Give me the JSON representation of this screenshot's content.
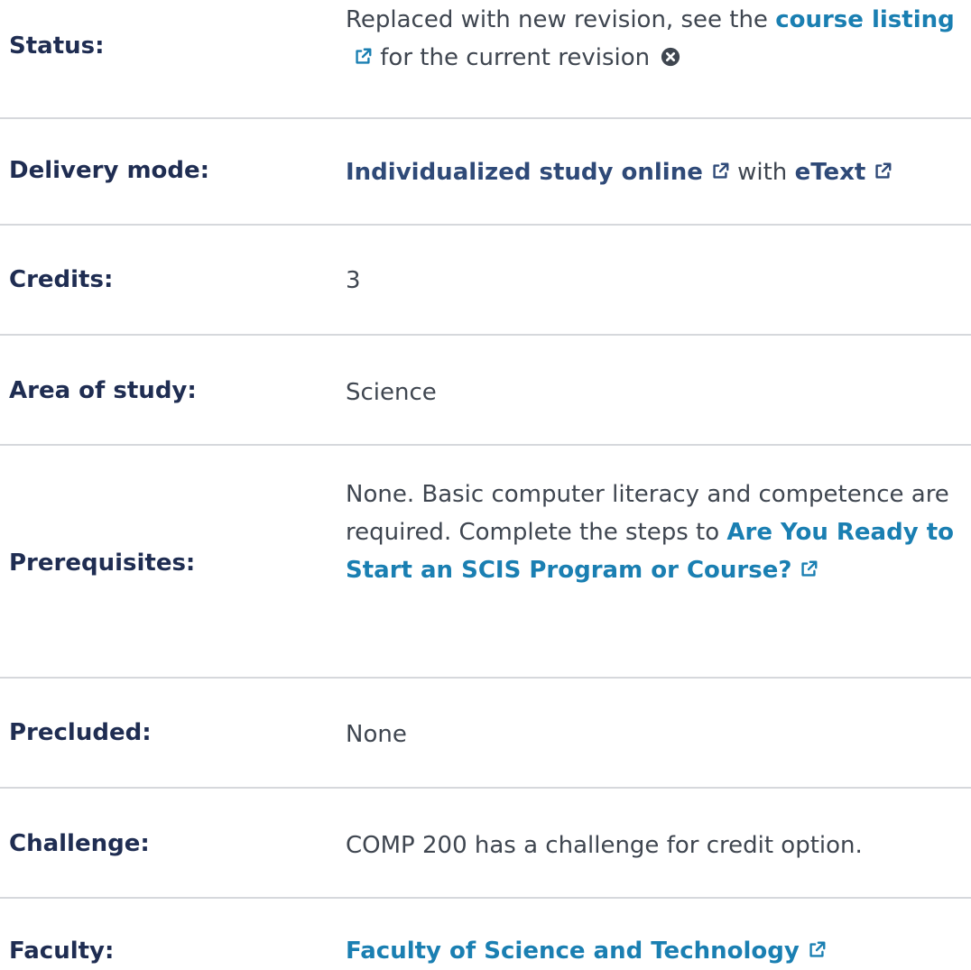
{
  "status": {
    "label": "Status:",
    "text_before": "Replaced with new revision, see the ",
    "link": "course listing",
    "text_after": " for the current revision",
    "icon": "times-circle-icon"
  },
  "delivery": {
    "label": "Delivery mode:",
    "link1": "Individualized study online",
    "middle": " with ",
    "link2": "eText"
  },
  "credits": {
    "label": "Credits:",
    "value": "3"
  },
  "area": {
    "label": "Area of study:",
    "value": "Science"
  },
  "prereq": {
    "label": "Prerequisites:",
    "text": "None. Basic computer literacy and competence are required. Complete the steps to ",
    "link": "Are You Ready to Start an SCIS Program or Course?"
  },
  "precluded": {
    "label": "Precluded:",
    "value": "None"
  },
  "challenge": {
    "label": "Challenge:",
    "value": "COMP 200 has a challenge for credit option."
  },
  "faculty": {
    "label": "Faculty:",
    "link": "Faculty of Science and Technology"
  },
  "colors": {
    "label": "#1f2d52",
    "teal_link": "#1a7fb2",
    "navy_link": "#2f4a78",
    "text": "#3f4650",
    "divider": "#d6d8dc"
  },
  "icons": {
    "external": "external-link-icon",
    "close": "times-circle-icon"
  }
}
